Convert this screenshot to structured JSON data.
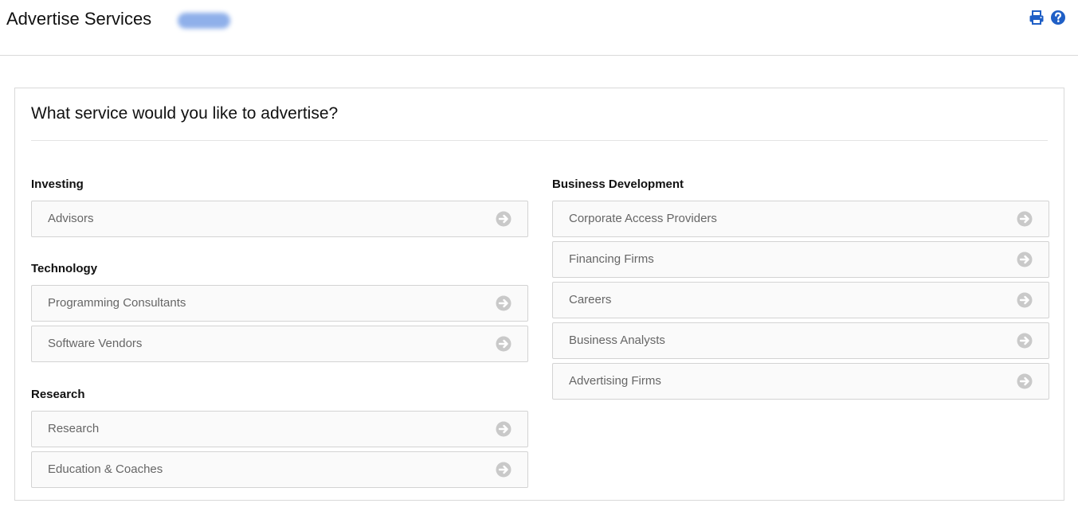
{
  "header": {
    "title": "Advertise Services",
    "icons": [
      "print-icon",
      "help-icon"
    ],
    "icon_color": "#1f5fc6"
  },
  "panel": {
    "question": "What service would you like to advertise?"
  },
  "left_groups": [
    {
      "title": "Investing",
      "items": [
        "Advisors"
      ]
    },
    {
      "title": "Technology",
      "items": [
        "Programming Consultants",
        "Software Vendors"
      ]
    },
    {
      "title": "Research",
      "items": [
        "Research",
        "Education & Coaches"
      ]
    }
  ],
  "right_groups": [
    {
      "title": "Business Development",
      "items": [
        "Corporate Access Providers",
        "Financing Firms",
        "Careers",
        "Business Analysts",
        "Advertising Firms"
      ]
    }
  ],
  "item_icon": "arrow-right-circle-icon"
}
